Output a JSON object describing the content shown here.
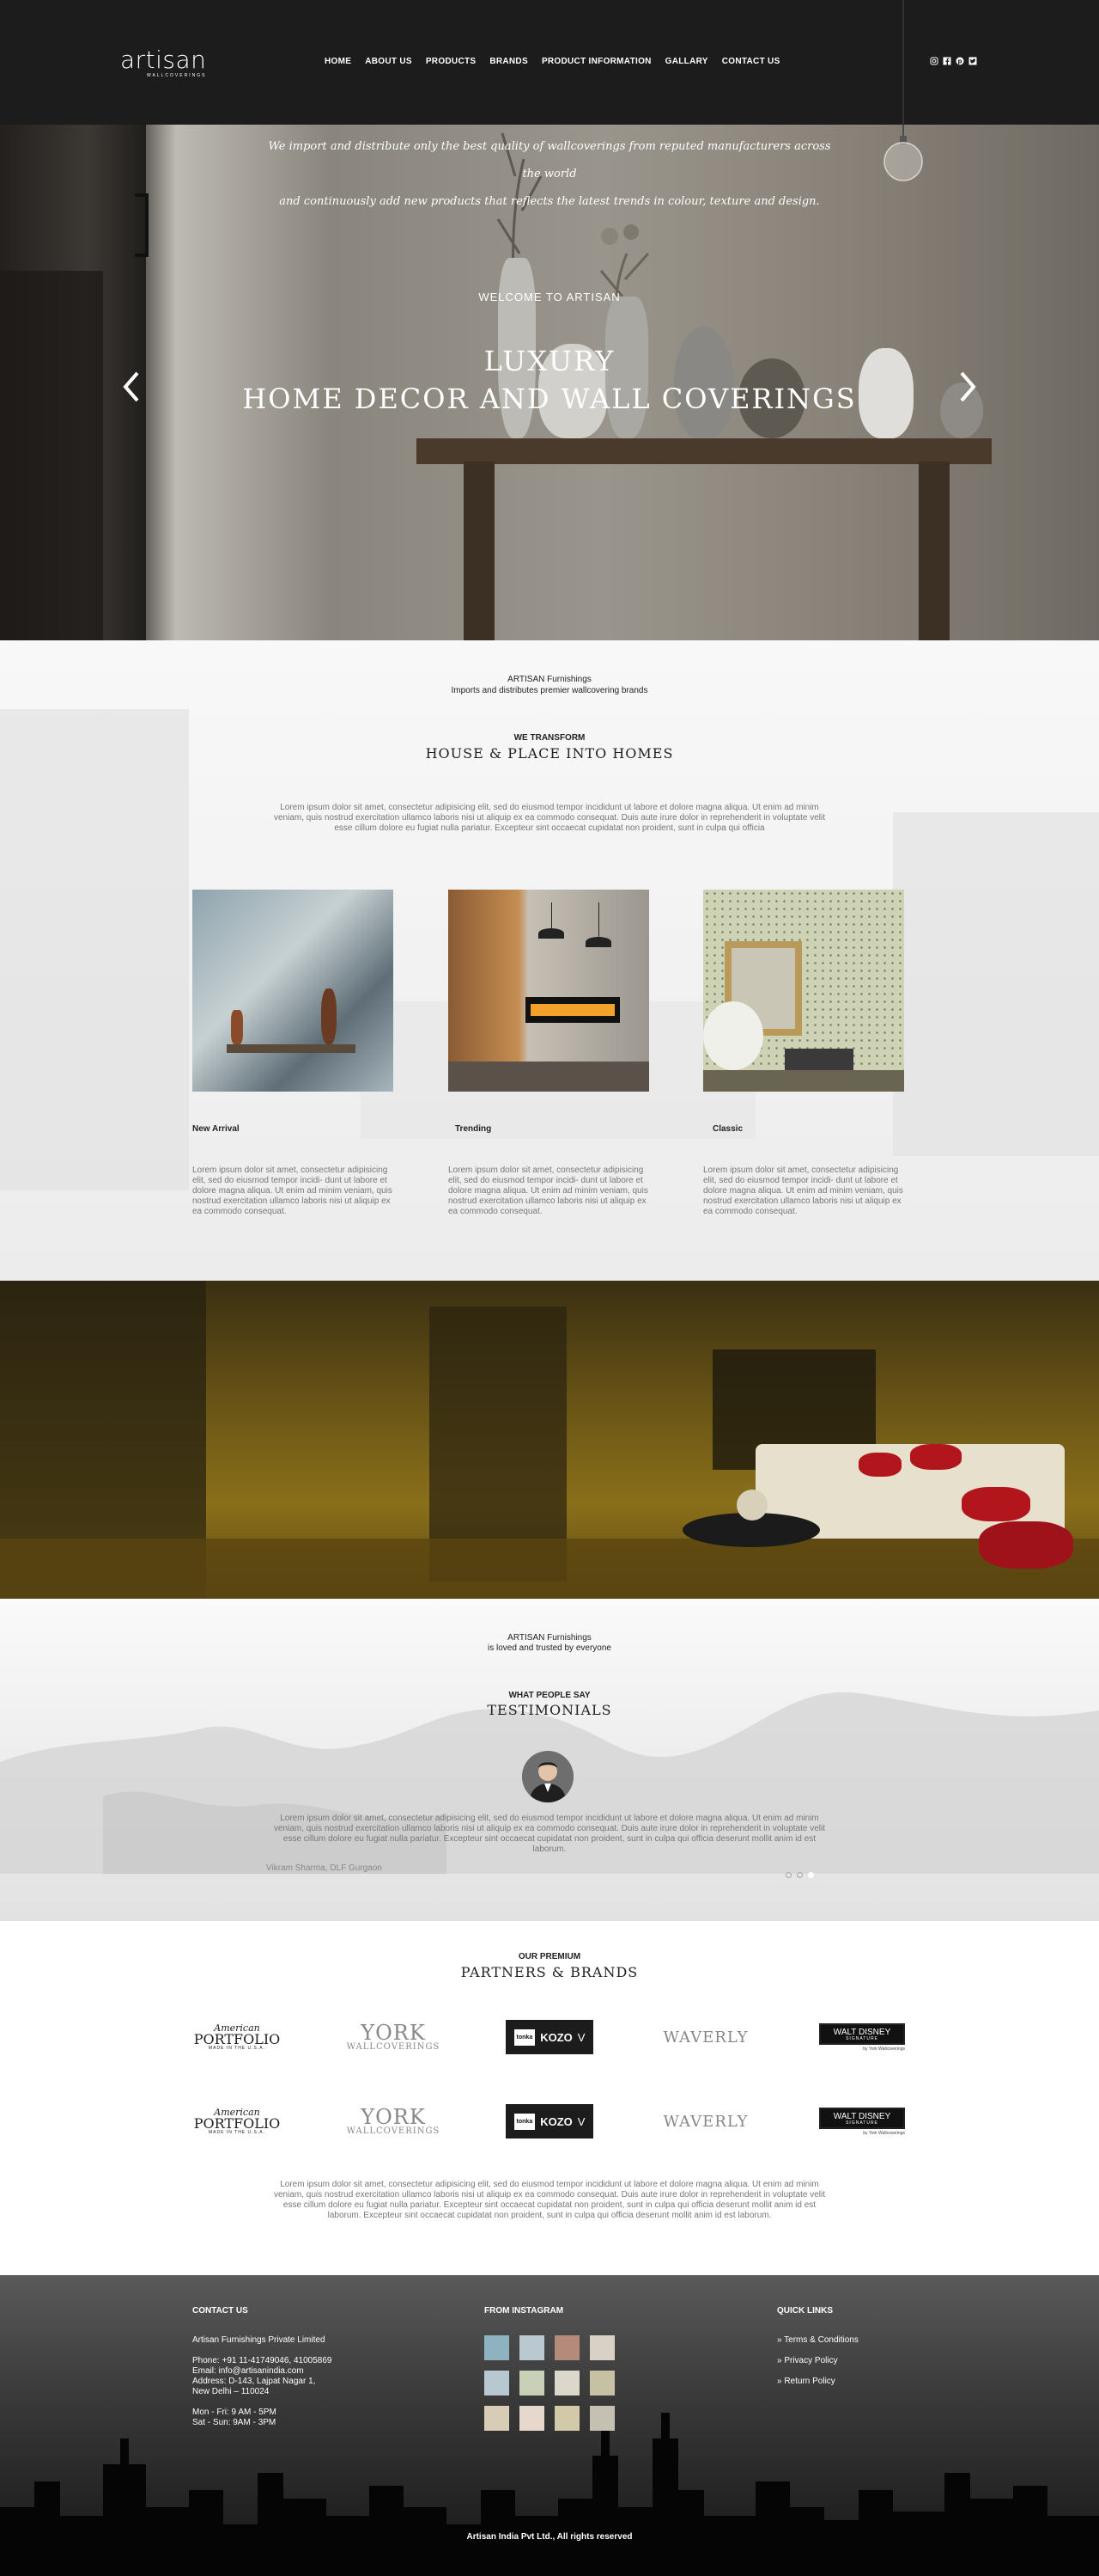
{
  "header": {
    "logo_text": "artisan",
    "logo_sub": "WALLCOVERINGS",
    "nav": [
      "HOME",
      "ABOUT US",
      "PRODUCTS",
      "BRANDS",
      "PRODUCT INFORMATION",
      "GALLARY",
      "CONTACT US"
    ],
    "social_icons": [
      "instagram-icon",
      "facebook-icon",
      "pinterest-icon",
      "twitter-icon"
    ]
  },
  "hero": {
    "caption": "WELCOME TO ARTISAN",
    "title_line1": "LUXURY",
    "title_line2": "HOME DECOR AND WALL COVERINGS"
  },
  "intro": {
    "company": "ARTISAN Furnishings",
    "tagline": "Imports and distributes premier wallcovering brands",
    "kicker": "WE TRANSFORM",
    "title": "HOUSE & PLACE INTO HOMES",
    "body": "Lorem ipsum dolor sit amet, consectetur adipisicing elit, sed do eiusmod tempor incididunt ut labore et dolore magna aliqua. Ut enim ad minim veniam, quis nostrud exercitation ullamco laboris nisi ut aliquip ex ea commodo consequat. Duis aute irure dolor in reprehenderit in voluptate velit esse cillum dolore eu fugiat nulla pariatur. Excepteur sint occaecat cupidatat non proident, sunt in culpa qui officia"
  },
  "cards": [
    {
      "label": "New Arrival",
      "text": "Lorem ipsum dolor sit amet, consectetur adipisicing elit, sed do eiusmod tempor incidi- dunt ut labore et dolore magna aliqua. Ut enim ad minim veniam, quis nostrud exercitation ullamco laboris nisi ut aliquip ex ea commodo consequat."
    },
    {
      "label": "Trending",
      "text": "Lorem ipsum dolor sit amet, consectetur adipisicing elit, sed do eiusmod tempor incidi- dunt ut labore et dolore magna aliqua. Ut enim ad minim veniam, quis nostrud exercitation ullamco laboris nisi ut aliquip ex ea commodo consequat."
    },
    {
      "label": "Classic",
      "text": "Lorem ipsum dolor sit amet, consectetur adipisicing elit, sed do eiusmod tempor incidi- dunt ut labore et dolore magna aliqua. Ut enim ad minim veniam, quis nostrud exercitation ullamco laboris nisi ut aliquip ex ea commodo consequat."
    }
  ],
  "banner": {
    "quote_line1": "We import and distribute only the best quality of wallcoverings from reputed manufacturers across the world",
    "quote_line2": "and continuously add new products that reflects the latest trends in colour, texture and design."
  },
  "testimonials": {
    "company": "ARTISAN Furnishings",
    "tagline": "is loved and trusted by everyone",
    "kicker": "WHAT PEOPLE SAY",
    "title": "TESTIMONIALS",
    "quote": "Lorem ipsum dolor sit amet, consectetur adipisicing elit, sed do eiusmod tempor incididunt ut labore et dolore magna aliqua. Ut enim ad minim veniam, quis nostrud exercitation ullamco laboris nisi ut aliquip ex ea commodo consequat. Duis aute irure dolor in reprehenderit in voluptate velit esse cillum dolore eu fugiat nulla pariatur. Excepteur sint occaecat cupidatat non proident, sunt in culpa qui officia deserunt mollit anim id est laborum.",
    "author": "Vikram Sharma, DLF Gurgaon"
  },
  "partners": {
    "kicker": "OUR PREMIUM",
    "title": "PARTNERS & BRANDS",
    "brands": [
      "American PORTFOLIO",
      "YORK WALLCOVERINGS",
      "KOZO V",
      "WAVERLY",
      "WALT DISNEY"
    ],
    "portfolio_main": "PORTFOLIO",
    "portfolio_script": "American",
    "portfolio_small": "MADE IN THE U.S.A.",
    "york_main": "YORK",
    "york_sub": "WALLCOVERINGS",
    "kozo_badge": "tonka",
    "kozo_main": "KOZO",
    "kozo_v": "V",
    "waverly": "WAVERLY",
    "disney_main": "WALT DISNEY",
    "disney_sig": "SIGNATURE",
    "disney_by": "by York Wallcoverings",
    "body": "Lorem ipsum dolor sit amet, consectetur adipisicing elit, sed do eiusmod tempor incididunt ut labore et dolore magna aliqua. Ut enim ad minim veniam, quis nostrud exercitation ullamco laboris nisi ut aliquip ex ea commodo consequat. Duis aute irure dolor in reprehenderit in voluptate velit esse cillum dolore eu fugiat nulla pariatur. Excepteur sint occaecat cupidatat non proident, sunt in culpa qui officia deserunt mollit anim id est laborum. Excepteur sint occaecat cupidatat non proident, sunt in culpa qui officia deserunt mollit anim id est laborum."
  },
  "footer": {
    "contact_head": "CONTACT US",
    "company": "Artisan Furnishings Private Limited",
    "phone": "Phone: +91 11-41749046, 41005869",
    "email": "Email: info@artisanindia.com",
    "address1": "Address: D-143, Lajpat Nagar 1,",
    "address2": "New Delhi – 110024",
    "hours1": "Mon - Fri: 9 AM - 5PM",
    "hours2": "Sat - Sun: 9AM - 3PM",
    "insta_head": "FROM INSTAGRAM",
    "links_head": "QUICK LINKS",
    "links": [
      "» Terms & Conditions",
      "» Privacy Policy",
      "» Return Policy"
    ],
    "copyright": "Artisan India Pvt Ltd., All rights reserved"
  },
  "colors": {
    "header_bg": "#1c1c1c",
    "banner_gold": "#8a6f1a",
    "text_dark": "#222222",
    "text_muted": "#777777"
  }
}
